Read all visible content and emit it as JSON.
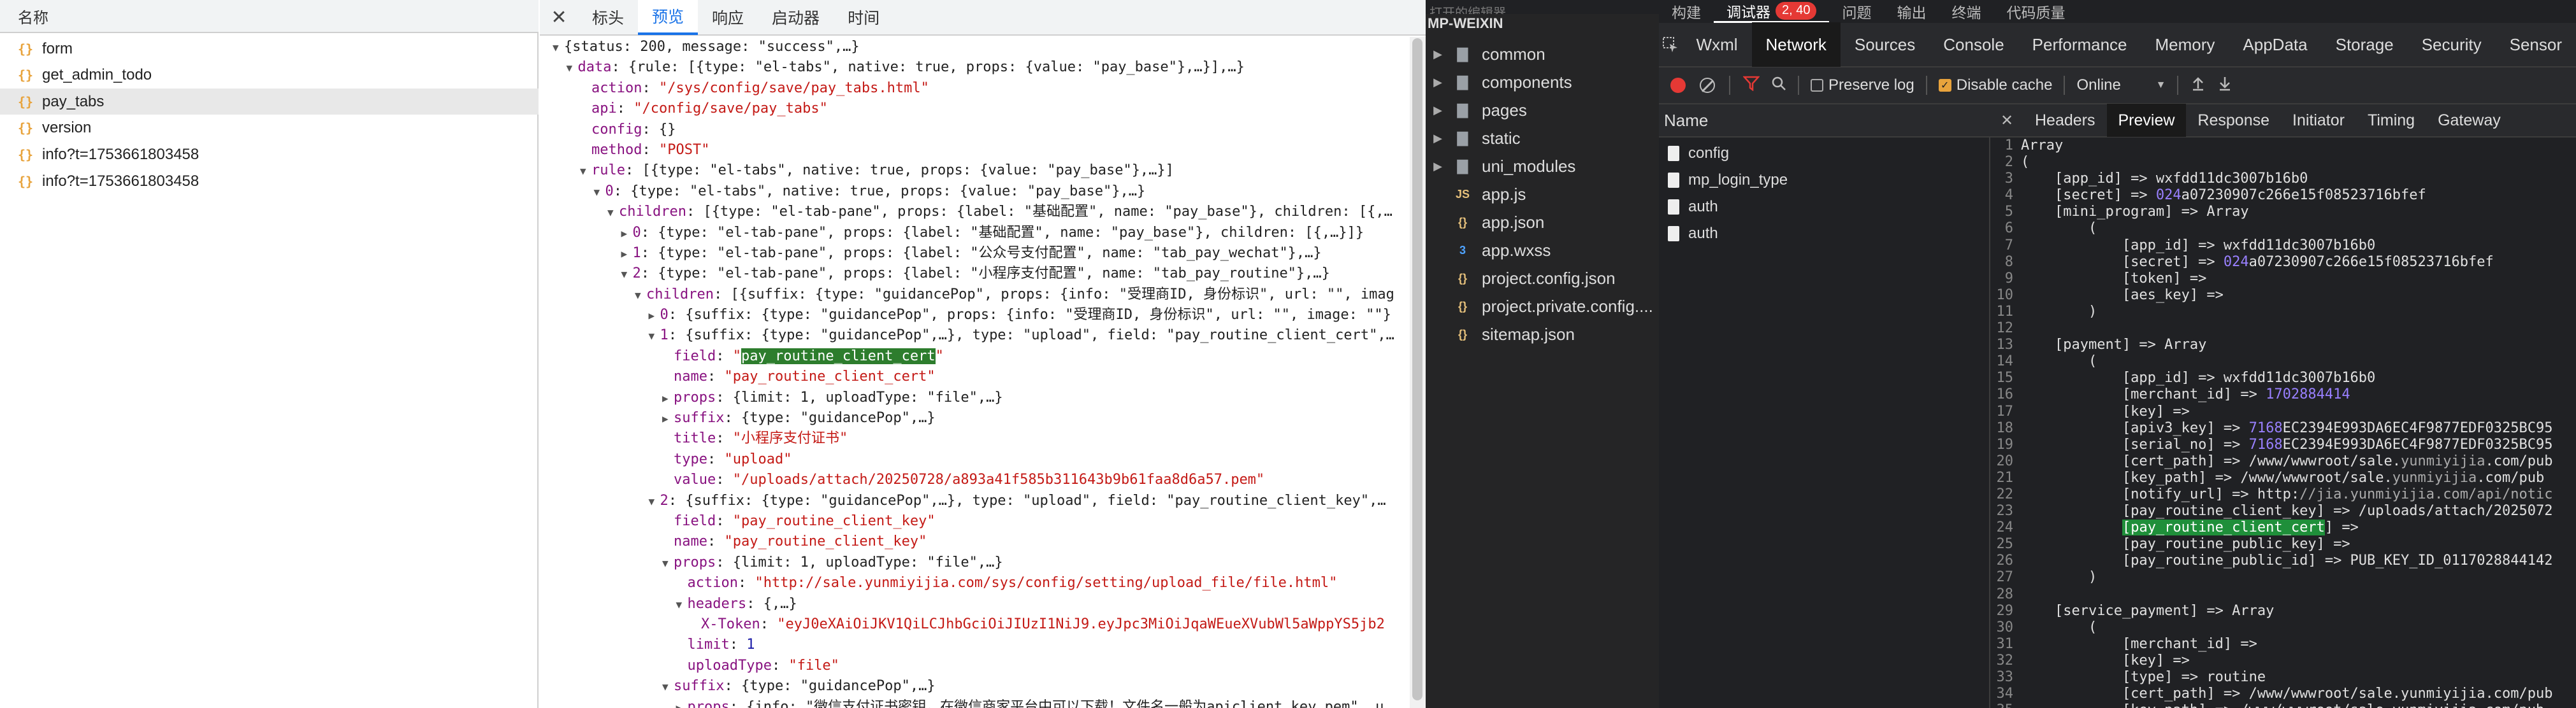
{
  "left": {
    "name_header": "名称",
    "requests": [
      {
        "name": "form"
      },
      {
        "name": "get_admin_todo"
      },
      {
        "name": "pay_tabs",
        "selected": true
      },
      {
        "name": "version"
      },
      {
        "name": "info?t=1753661803458"
      },
      {
        "name": "info?t=1753661803458"
      }
    ],
    "detail_tabs": [
      "标头",
      "预览",
      "响应",
      "启动器",
      "时间"
    ],
    "active_tab": "预览",
    "preview_lines": [
      {
        "i": 0,
        "t": "▼",
        "h": "{status: 200, message: \"success\",…}"
      },
      {
        "i": 1,
        "t": "▼",
        "h": "<k>data</k>: {rule: [{type: \"el-tabs\", native: true, props: {value: \"pay_base\"},…}],…}"
      },
      {
        "i": 2,
        "t": "",
        "h": "<k>action</k>: <s>\"/sys/config/save/pay_tabs.html\"</s>"
      },
      {
        "i": 2,
        "t": "",
        "h": "<k>api</k>: <s>\"/config/save/pay_tabs\"</s>"
      },
      {
        "i": 2,
        "t": "",
        "h": "<k>config</k>: {}"
      },
      {
        "i": 2,
        "t": "",
        "h": "<k>method</k>: <s>\"POST\"</s>"
      },
      {
        "i": 2,
        "t": "▼",
        "h": "<k>rule</k>: [{type: \"el-tabs\", native: true, props: {value: \"pay_base\"},…}]"
      },
      {
        "i": 3,
        "t": "▼",
        "h": "<k>0</k>: {type: \"el-tabs\", native: true, props: {value: \"pay_base\"},…}"
      },
      {
        "i": 4,
        "t": "▼",
        "h": "<k>children</k>: [{type: \"el-tab-pane\", props: {label: \"基础配置\", name: \"pay_base\"}, children: [{,…"
      },
      {
        "i": 5,
        "t": "▶",
        "h": "<k>0</k>: {type: \"el-tab-pane\", props: {label: \"基础配置\", name: \"pay_base\"}, children: [{,…}]}"
      },
      {
        "i": 5,
        "t": "▶",
        "h": "<k>1</k>: {type: \"el-tab-pane\", props: {label: \"公众号支付配置\", name: \"tab_pay_wechat\"},…}"
      },
      {
        "i": 5,
        "t": "▼",
        "h": "<k>2</k>: {type: \"el-tab-pane\", props: {label: \"小程序支付配置\", name: \"tab_pay_routine\"},…}"
      },
      {
        "i": 6,
        "t": "▼",
        "h": "<k>children</k>: [{suffix: {type: \"guidancePop\", props: {info: \"受理商ID, 身份标识\", url: \"\", imag"
      },
      {
        "i": 7,
        "t": "▶",
        "h": "<k>0</k>: {suffix: {type: \"guidancePop\", props: {info: \"受理商ID, 身份标识\", url: \"\", image: \"\"}"
      },
      {
        "i": 7,
        "t": "▼",
        "h": "<k>1</k>: {suffix: {type: \"guidancePop\",…}, type: \"upload\", field: \"pay_routine_client_cert\",…"
      },
      {
        "i": 8,
        "t": "",
        "h": "<k>field</k>: <s>\"</s><hl>pay_routine_client_cert</hl><s>\"</s>"
      },
      {
        "i": 8,
        "t": "",
        "h": "<k>name</k>: <s>\"pay_routine_client_cert\"</s>"
      },
      {
        "i": 8,
        "t": "▶",
        "h": "<k>props</k>: {limit: 1, uploadType: \"file\",…}"
      },
      {
        "i": 8,
        "t": "▶",
        "h": "<k>suffix</k>: {type: \"guidancePop\",…}"
      },
      {
        "i": 8,
        "t": "",
        "h": "<k>title</k>: <s>\"小程序支付证书\"</s>"
      },
      {
        "i": 8,
        "t": "",
        "h": "<k>type</k>: <s>\"upload\"</s>"
      },
      {
        "i": 8,
        "t": "",
        "h": "<k>value</k>: <s>\"/uploads/attach/20250728/a893a41f585b311643b9b61faa8d6a57.pem\"</s>"
      },
      {
        "i": 7,
        "t": "▼",
        "h": "<k>2</k>: {suffix: {type: \"guidancePop\",…}, type: \"upload\", field: \"pay_routine_client_key\",…"
      },
      {
        "i": 8,
        "t": "",
        "h": "<k>field</k>: <s>\"pay_routine_client_key\"</s>"
      },
      {
        "i": 8,
        "t": "",
        "h": "<k>name</k>: <s>\"pay_routine_client_key\"</s>"
      },
      {
        "i": 8,
        "t": "▼",
        "h": "<k>props</k>: {limit: 1, uploadType: \"file\",…}"
      },
      {
        "i": 9,
        "t": "",
        "h": "<k>action</k>: <s>\"http://sale.yunmiyijia.com/sys/config/setting/upload_file/file.html\"</s>"
      },
      {
        "i": 9,
        "t": "▼",
        "h": "<k>headers</k>: {,…}"
      },
      {
        "i": 10,
        "t": "",
        "h": "<k>X-Token</k>: <s>\"eyJ0eXAiOiJKV1QiLCJhbGciOiJIUzI1NiJ9.eyJpc3MiOiJqaWEueXVubWl5aWppYS5jb2</s>"
      },
      {
        "i": 9,
        "t": "",
        "h": "<k>limit</k>: <n>1</n>"
      },
      {
        "i": 9,
        "t": "",
        "h": "<k>uploadType</k>: <s>\"file\"</s>"
      },
      {
        "i": 8,
        "t": "▼",
        "h": "<k>suffix</k>: {type: \"guidancePop\",…}"
      },
      {
        "i": 9,
        "t": "▶",
        "h": "<k>props</k>: {info: \"微信支付证书密钥，在微信商家平台中可以下载！文件名一般为apiclient_key.pem\", u"
      }
    ]
  },
  "right": {
    "top_tabs": [
      "构建",
      "调试器",
      "问题",
      "输出",
      "终端",
      "代码质量"
    ],
    "active_top_tab": "调试器",
    "debugger_badge": "2, 40",
    "project_title": "MP-WEIXIN",
    "top_title_partial": "打开的编辑器",
    "files": [
      {
        "name": "common",
        "kind": "folder"
      },
      {
        "name": "components",
        "kind": "folder"
      },
      {
        "name": "pages",
        "kind": "folder"
      },
      {
        "name": "static",
        "kind": "folder"
      },
      {
        "name": "uni_modules",
        "kind": "folder"
      },
      {
        "name": "app.js",
        "kind": "js"
      },
      {
        "name": "app.json",
        "kind": "json"
      },
      {
        "name": "app.wxss",
        "kind": "css"
      },
      {
        "name": "project.config.json",
        "kind": "json"
      },
      {
        "name": "project.private.config....",
        "kind": "json"
      },
      {
        "name": "sitemap.json",
        "kind": "json"
      }
    ],
    "panel_tabs": [
      "Wxml",
      "Network",
      "Sources",
      "Console",
      "Performance",
      "Memory",
      "AppData",
      "Storage",
      "Security",
      "Sensor"
    ],
    "active_panel_tab": "Network",
    "toolbar": {
      "preserve_log": "Preserve log",
      "preserve_log_checked": false,
      "disable_cache": "Disable cache",
      "disable_cache_checked": true,
      "throttle": "Online"
    },
    "net_name_header": "Name",
    "net_requests": [
      "config",
      "mp_login_type",
      "auth",
      "auth"
    ],
    "detail_tabs": [
      "Headers",
      "Preview",
      "Response",
      "Initiator",
      "Timing",
      "Gateway"
    ],
    "active_detail_tab": "Preview",
    "code_lines": [
      "Array",
      "(",
      "    [app_id] => wxfdd11dc3007b16b0",
      "    [secret] => <cn>024</cn>a07230907c266e15f08523716bfef",
      "    [mini_program] => Array",
      "        (",
      "            [app_id] => wxfdd11dc3007b16b0",
      "            [secret] => <cn>024</cn>a07230907c266e15f08523716bfef",
      "            [token] =>",
      "            [aes_key] =>",
      "        )",
      "",
      "    [payment] => Array",
      "        (",
      "            [app_id] => wxfdd11dc3007b16b0",
      "            [merchant_id] => <cn>1702884414</cn>",
      "            [key] =>",
      "            [apiv3_key] => <cn>7168</cn>EC2394E993DA6EC4F9877EDF0325BC95",
      "            [serial_no] => <cn>7168</cn>EC2394E993DA6EC4F9877EDF0325BC95",
      "            [cert_path] => /www/wwwroot/sale.<cm>yunmiyijia</cm>.com/pub",
      "            [key_path] => /www/wwwroot/sale.<cm>yunmiyijia</cm>.com/pub",
      "            [notify_url] => http:<cm>//jia.yunmiyijia.com/api/notic</cm>",
      "            [pay_routine_client_key] => /uploads/attach/2025072",
      "            <ch>[pay_routine_client_cert</ch>] =>",
      "            [pay_routine_public_key] =>",
      "            [pay_routine_public_id] => PUB_KEY_ID_0117028844142",
      "        )",
      "",
      "    [service_payment] => Array",
      "        (",
      "            [merchant_id] =>",
      "            [key] =>",
      "            [type] => routine",
      "            [cert_path] => /www/wwwroot/sale.yunmiyijia.com/pub",
      "            [key_path] => /www/wwwroot/sale.yunmiyijia.com/pub"
    ]
  },
  "colors": {
    "accent": "#1a73e8",
    "key": "#881280",
    "string": "#c41a16",
    "highlight": "#2d7d2d",
    "badge": "#e53935"
  }
}
